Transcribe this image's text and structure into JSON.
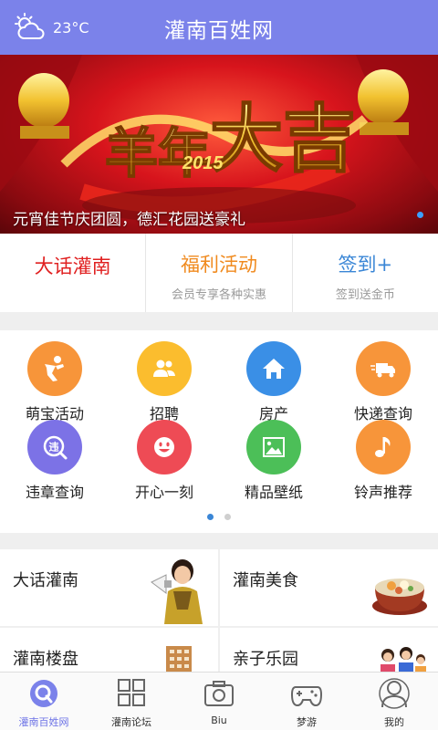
{
  "header": {
    "temperature": "23°C",
    "title": "灌南百姓网"
  },
  "banner": {
    "caption": "元宵佳节庆团圆，德汇花园送豪礼",
    "art_text": "大吉",
    "art_year": "2015",
    "art_prefix": "羊年"
  },
  "tabs": [
    {
      "title": "大话灌南",
      "subtitle": "",
      "color": "#e02020"
    },
    {
      "title": "福利活动",
      "subtitle": "会员专享各种实惠",
      "color": "#f08a1e"
    },
    {
      "title": "签到+",
      "subtitle": "签到送金币",
      "color": "#3a86d6"
    }
  ],
  "grid": [
    {
      "label": "萌宝活动",
      "icon": "baby-icon",
      "color": "#f7953a"
    },
    {
      "label": "招聘",
      "icon": "people-icon",
      "color": "#fbbd2e"
    },
    {
      "label": "房产",
      "icon": "house-icon",
      "color": "#3a8fe6"
    },
    {
      "label": "快递查询",
      "icon": "truck-icon",
      "color": "#f7953a"
    },
    {
      "label": "违章查询",
      "icon": "violation-icon",
      "color": "#7c72e6"
    },
    {
      "label": "开心一刻",
      "icon": "smile-icon",
      "color": "#ee4b55"
    },
    {
      "label": "精品壁纸",
      "icon": "picture-icon",
      "color": "#4cbf58"
    },
    {
      "label": "铃声推荐",
      "icon": "music-icon",
      "color": "#f7953a"
    }
  ],
  "pager": {
    "active_color": "#3a86d6",
    "inactive_color": "#cfcfcf"
  },
  "cards": [
    {
      "title": "大话灌南",
      "icon": "megaphone-man-icon"
    },
    {
      "title": "灌南美食",
      "icon": "food-bowl-icon"
    },
    {
      "title": "灌南楼盘",
      "icon": "building-icon"
    },
    {
      "title": "亲子乐园",
      "icon": "family-icon"
    }
  ],
  "nav": [
    {
      "label": "灌南百姓网",
      "icon": "home-logo-icon",
      "active": true
    },
    {
      "label": "灌南论坛",
      "icon": "grid-icon",
      "active": false
    },
    {
      "label": "Biu",
      "icon": "camera-icon",
      "active": false
    },
    {
      "label": "梦游",
      "icon": "gamepad-icon",
      "active": false
    },
    {
      "label": "我的",
      "icon": "user-icon",
      "active": false
    }
  ],
  "colors": {
    "header_bg": "#7b82ea",
    "nav_active": "#6c72e6"
  }
}
